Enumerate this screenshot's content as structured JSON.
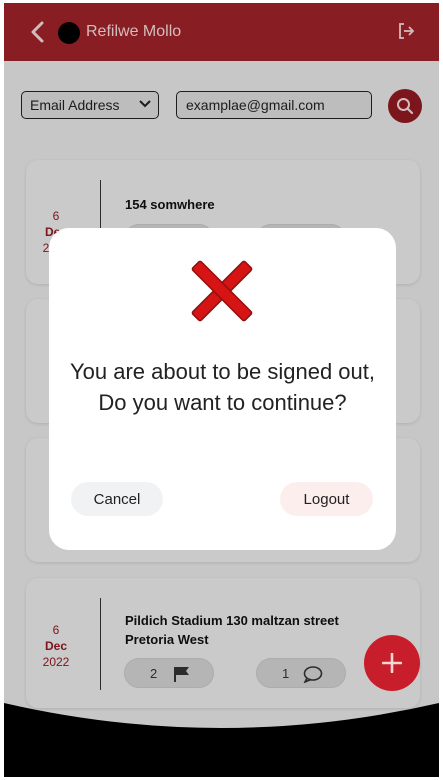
{
  "header": {
    "user_name": "Refilwe Mollo",
    "color": "#9b2228"
  },
  "filter": {
    "field_selected": "Email Address",
    "search_value": "examplae@gmail.com"
  },
  "cards": [
    {
      "day": "6",
      "month": "Dec",
      "year": "2022",
      "address_line1": "154 somwhere",
      "address_line2": ""
    },
    {
      "day": "6",
      "month": "Dec",
      "year": "2022",
      "address_line1": "Pildich Stadium 130 maltzan street",
      "address_line2": "Pretoria West",
      "flags": "2",
      "comments": "1"
    }
  ],
  "dialog": {
    "message": "You are about to be signed out, Do you want to continue?",
    "cancel_label": "Cancel",
    "logout_label": "Logout",
    "icon": "red-x-icon"
  },
  "fab": {
    "icon": "plus-icon",
    "color": "#c81d2b"
  }
}
